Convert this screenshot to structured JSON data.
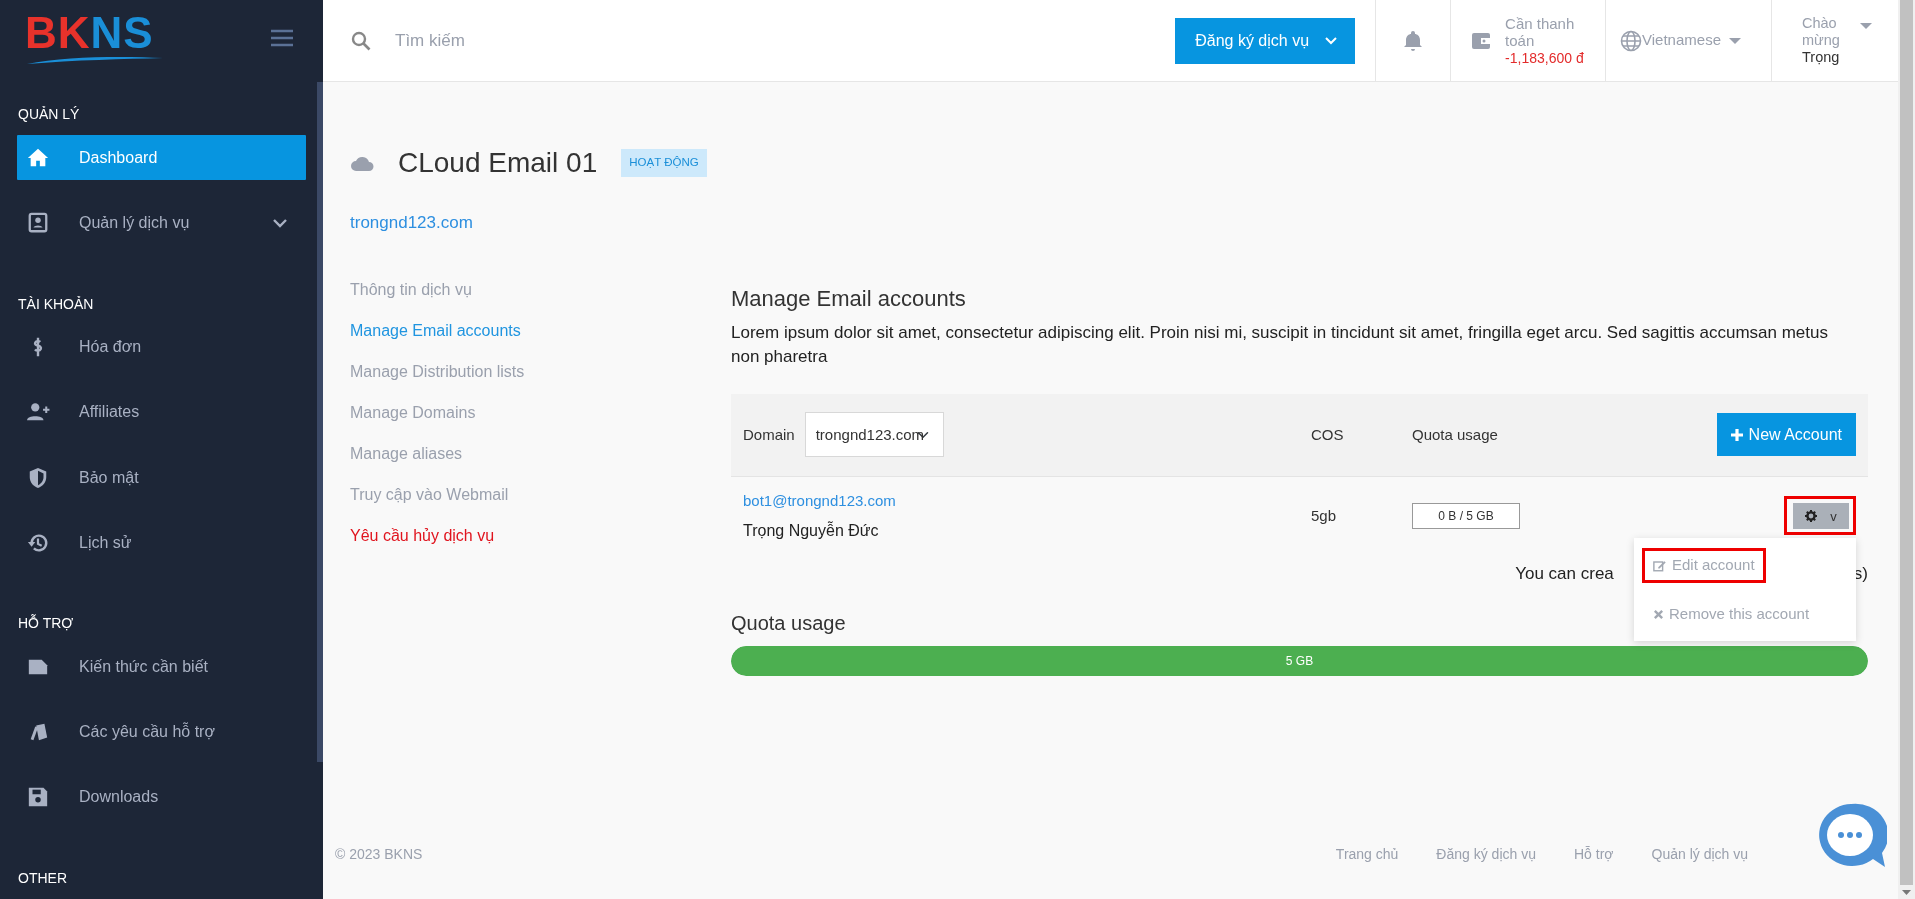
{
  "sidebar": {
    "logo": [
      {
        "text": "BK",
        "color": "#e8322b"
      },
      {
        "text": "NS",
        "color": "#1a8fd8"
      }
    ],
    "sections": [
      {
        "title": "QUẢN LÝ",
        "items": [
          {
            "label": "Dashboard",
            "kind": "link",
            "selected": true
          },
          {
            "label": "Quản lý dịch vụ",
            "kind": "group",
            "selected": false
          }
        ]
      },
      {
        "title": "TÀI KHOẢN",
        "items": [
          {
            "label": "Hóa đơn",
            "kind": "link",
            "selected": false
          },
          {
            "label": "Affiliates",
            "kind": "link",
            "selected": false
          },
          {
            "label": "Bảo mật",
            "kind": "link",
            "selected": false
          },
          {
            "label": "Lịch sử",
            "kind": "link",
            "selected": false
          }
        ]
      },
      {
        "title": "HỖ TRỢ",
        "items": [
          {
            "label": "Kiến thức cần biết",
            "kind": "link",
            "selected": false
          },
          {
            "label": "Các yêu cầu hỗ trợ",
            "kind": "link",
            "selected": false
          },
          {
            "label": "Downloads",
            "kind": "link",
            "selected": false
          }
        ]
      },
      {
        "title": "OTHER"
      }
    ]
  },
  "topbar": {
    "search": {
      "placeholder": "Tìm kiếm"
    },
    "register_button": "Đăng ký dịch vụ",
    "payment": {
      "label": "Cần thanh toán",
      "amount": "-1,183,600 đ"
    },
    "language": "Vietnamese",
    "greeting": {
      "label": "Chào mừng",
      "name": "Trọng"
    }
  },
  "service": {
    "title": "CLoud Email 01",
    "status": "HOẠT ĐỘNG",
    "domain": "trongnd123.com"
  },
  "subnav": [
    {
      "label": "Thông tin dịch vụ",
      "kind": "link",
      "selected": false
    },
    {
      "label": "Manage Email accounts",
      "kind": "link",
      "selected": true
    },
    {
      "label": "Manage Distribution lists",
      "kind": "link",
      "selected": false
    },
    {
      "label": "Manage Domains",
      "kind": "link",
      "selected": false
    },
    {
      "label": "Manage aliases",
      "kind": "link",
      "selected": false
    },
    {
      "label": "Truy cập vào Webmail",
      "kind": "link",
      "selected": false
    },
    {
      "label": "Yêu cầu hủy dịch vụ",
      "kind": "danger",
      "selected": false
    }
  ],
  "accounts": {
    "heading": "Manage Email accounts",
    "description": "Lorem ipsum dolor sit amet, consectetur adipiscing elit. Proin nisi mi, suscipit in tincidunt sit amet, fringilla eget arcu. Sed sagittis accumsan metus non pharetra",
    "table": {
      "domain_label": "Domain",
      "domain_select": "trongnd123.com",
      "columns": [
        "COS",
        "Quota usage"
      ],
      "new_account_button": "New Account",
      "rows": [
        {
          "email": "bot1@trongnd123.com",
          "name": "Trọng Nguyễn Đức",
          "cos": "5gb",
          "quota": "0 B / 5 GB",
          "action_toggle": "v",
          "highlighted": true
        }
      ]
    },
    "dropdown": [
      {
        "label": "Edit account",
        "highlighted": true
      },
      {
        "label": "Remove this account",
        "highlighted": false
      }
    ],
    "notice_parts": [
      "You can crea",
      "s)"
    ]
  },
  "quota": {
    "heading": "Quota usage",
    "label": "5 GB",
    "level": 1.0
  },
  "footer": {
    "copyright": "© 2023 BKNS",
    "links": [
      "Trang chủ",
      "Đăng ký dịch vụ",
      "Hỗ trợ",
      "Quản lý dịch vụ"
    ]
  }
}
